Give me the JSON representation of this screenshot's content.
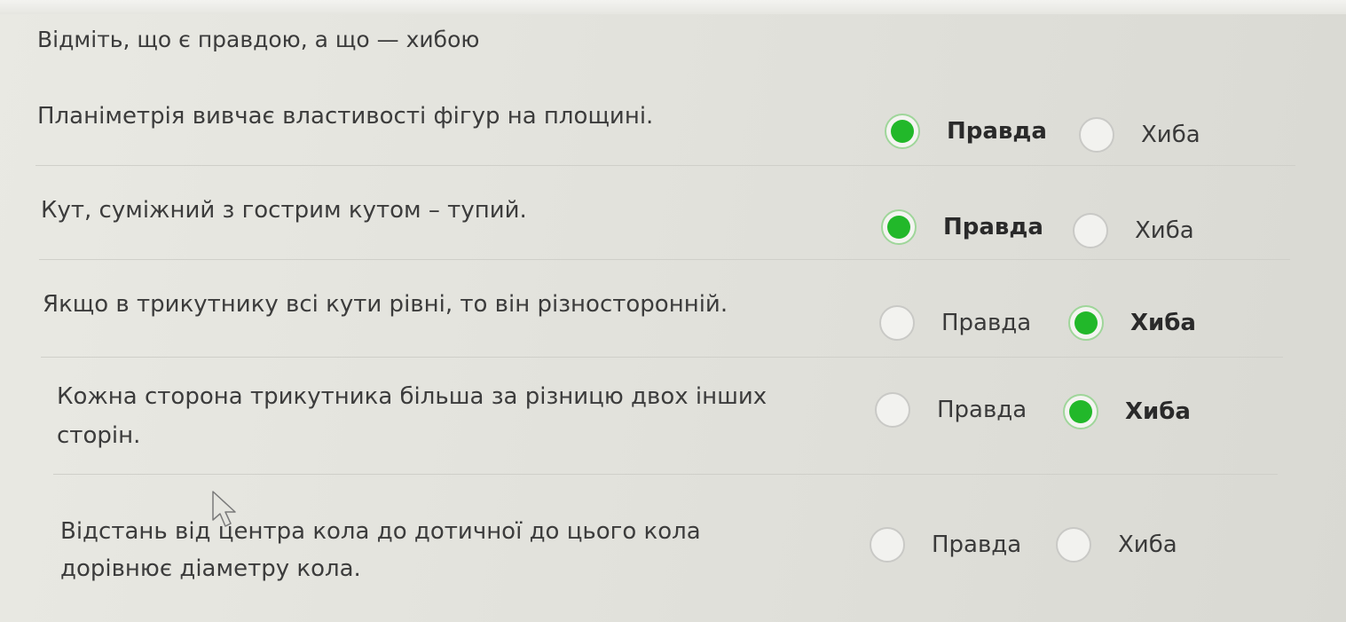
{
  "instruction": "Відміть, що є правдою, а що — хибою",
  "questions": [
    {
      "text": "Планіметрія вивчає властивості фігур на площині.",
      "true_label": "Правда",
      "false_label": "Хиба",
      "selected": "true"
    },
    {
      "text": "Кут, суміжний з гострим кутом – тупий.",
      "true_label": "Правда",
      "false_label": "Хиба",
      "selected": "true"
    },
    {
      "text": "Якщо в трикутнику всі кути рівні, то він різносторонній.",
      "true_label": "Правда",
      "false_label": "Хиба",
      "selected": "false"
    },
    {
      "text_line1": "Кожна сторона трикутника більша за різницю двох інших",
      "text_line2": "сторін.",
      "true_label": "Правда",
      "false_label": "Хиба",
      "selected": "false"
    },
    {
      "text_line1": "Відстань від центра кола до дотичної до цього кола",
      "text_line2": "дорівнює діаметру кола.",
      "true_label": "Правда",
      "false_label": "Хиба",
      "selected": "none"
    }
  ],
  "colors": {
    "selected": "#22b82a",
    "ring": "#9fd69a"
  }
}
